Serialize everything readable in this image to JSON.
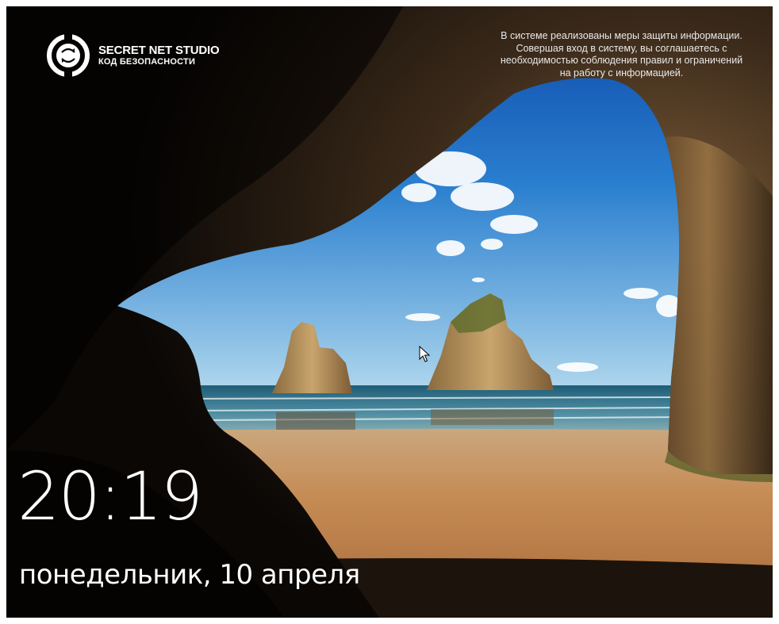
{
  "branding": {
    "product_name": "SECRET NET STUDIO",
    "product_subtitle": "КОД БЕЗОПАСНОСТИ",
    "logo_icon": "secret-net-studio-logo"
  },
  "security_notice": {
    "lines": [
      "В системе реализованы меры защиты информации.",
      "Совершая вход в систему, вы соглашаетесь с",
      "необходимостью соблюдения правил и ограничений",
      "на работу с информацией."
    ]
  },
  "lock_screen": {
    "time": "20:19",
    "date": "понедельник, 10 апреля"
  },
  "cursor_icon": "mouse-pointer-icon",
  "colors": {
    "sky_top": "#0d4fb2",
    "sky_horizon": "#9cc9e6",
    "sea": "#2f6e86",
    "sand": "#c48a52",
    "cave": "#2a1d12"
  }
}
